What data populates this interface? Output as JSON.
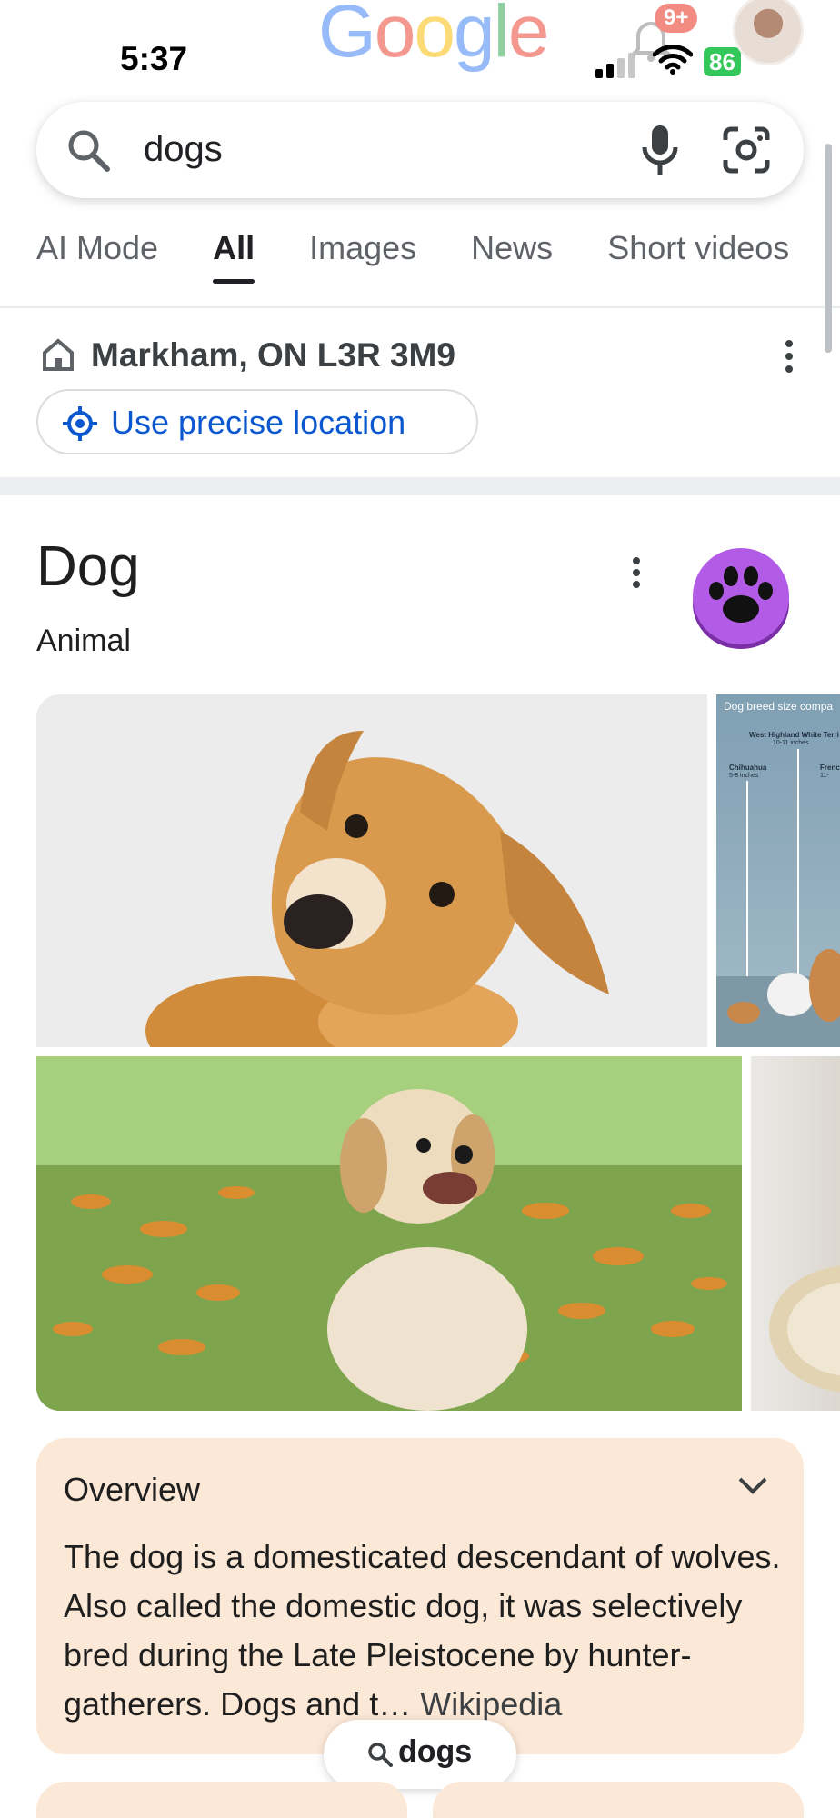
{
  "status_bar": {
    "time": "5:37",
    "notification_badge": "9+",
    "battery": "86"
  },
  "logo": {
    "letters": [
      "G",
      "o",
      "o",
      "g",
      "l",
      "e"
    ]
  },
  "search": {
    "query": "dogs",
    "icons": [
      "search-icon",
      "mic-icon",
      "lens-icon"
    ]
  },
  "tabs": [
    {
      "label": "AI Mode",
      "active": false
    },
    {
      "label": "All",
      "active": true
    },
    {
      "label": "Images",
      "active": false
    },
    {
      "label": "News",
      "active": false
    },
    {
      "label": "Short videos",
      "active": false
    }
  ],
  "location": {
    "text": "Markham, ON L3R 3M9",
    "precise_button": "Use precise location"
  },
  "knowledge_panel": {
    "title": "Dog",
    "subtitle": "Animal",
    "icon": "paw-icon",
    "icon_color": "#a64ed8",
    "chart_image": {
      "title": "Dog breed size compa",
      "labels": [
        "West Highland White Terri",
        "10-11 inches",
        "Chihuahua",
        "5-8 inches",
        "Frenc",
        "11-"
      ]
    }
  },
  "overview": {
    "title": "Overview",
    "body": "The dog is a domesticated descendant of wolves. Also called the domestic dog, it was selectively bred during the Late Pleistocene by hunter-gatherers. Dogs and t…",
    "source": "Wikipedia"
  },
  "floating_search": {
    "text": "dogs"
  },
  "colors": {
    "accent_blue": "#0b57d0",
    "overview_bg": "#fce8d6",
    "battery_green": "#34c759"
  }
}
